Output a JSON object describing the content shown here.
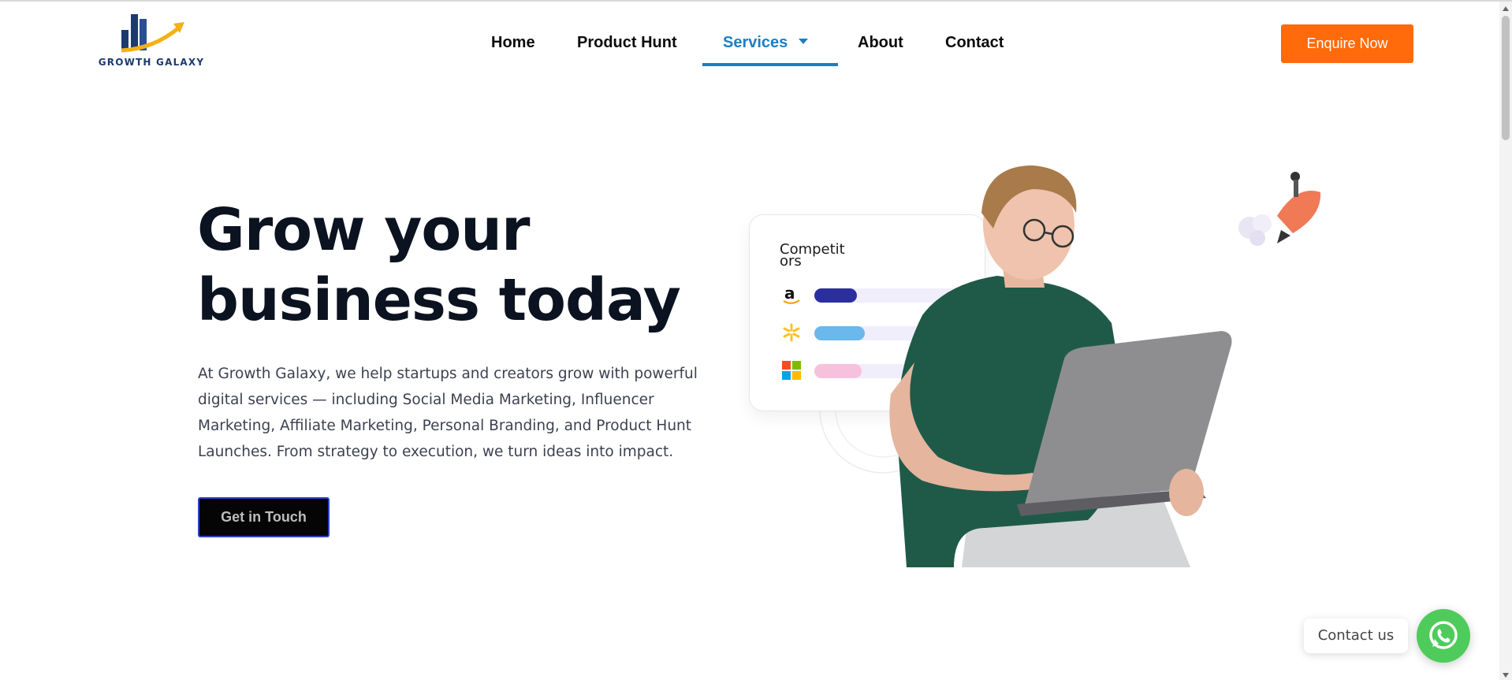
{
  "brand": {
    "name": "GROWTH GALAXY"
  },
  "nav": {
    "items": [
      {
        "label": "Home"
      },
      {
        "label": "Product Hunt"
      },
      {
        "label": "Services"
      },
      {
        "label": "About"
      },
      {
        "label": "Contact"
      }
    ],
    "active": "Services"
  },
  "header": {
    "cta_label": "Enquire Now"
  },
  "hero": {
    "title_line1": "Grow your",
    "title_line2": "business today",
    "description": " At Growth Galaxy, we help startups and creators grow with powerful digital services — including Social Media Marketing, Influencer Marketing, Affiliate Marketing, Personal Branding, and Product Hunt Launches. From strategy to execution, we turn ideas into impact.",
    "button_label": "Get in Touch"
  },
  "illustration": {
    "card_title": "Competit ors",
    "brands": [
      "amazon-icon",
      "walmart-icon",
      "microsoft-icon"
    ]
  },
  "chat": {
    "label": "Contact us"
  },
  "colors": {
    "accent": "#1a7fc4",
    "cta": "#ff6a0b",
    "whatsapp": "#4fcb5c",
    "dark": "#0b1220"
  }
}
